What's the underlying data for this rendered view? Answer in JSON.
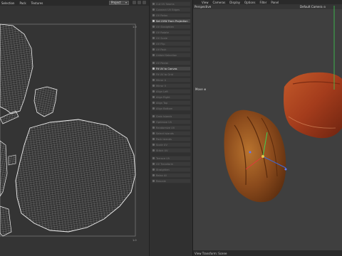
{
  "uv_editor": {
    "menu": [
      "Selection",
      "Pack",
      "Textures"
    ],
    "mode_dropdown": "Project",
    "tick_top": "1.0",
    "tick_bottom": "1.0"
  },
  "tools": [
    {
      "label": "Cut UV Seams",
      "active": false
    },
    {
      "label": "Connect UV Edges",
      "active": false
    },
    {
      "label": "UV Relax",
      "active": false
    },
    {
      "label": "Set UVW From Projection",
      "active": true
    },
    {
      "label": "UV Straighten",
      "active": false
    },
    {
      "label": "UV Rotate",
      "active": false
    },
    {
      "label": "UV Scale",
      "active": false
    },
    {
      "label": "UV Flip",
      "active": false
    },
    {
      "label": "UV Pack",
      "active": false
    },
    {
      "label": "Unfold Selection",
      "active": false
    },
    {
      "label": "UV Peeler",
      "active": false
    },
    {
      "label": "Fit UV to Canvas",
      "active": true
    },
    {
      "label": "Fit UV to Grid",
      "active": false
    },
    {
      "label": "Mirror U",
      "active": false
    },
    {
      "label": "Mirror V",
      "active": false
    },
    {
      "label": "Align Left",
      "active": false
    },
    {
      "label": "Align Right",
      "active": false
    },
    {
      "label": "Align Top",
      "active": false
    },
    {
      "label": "Align Bottom",
      "active": false
    },
    {
      "label": "Grab Islands",
      "active": false
    },
    {
      "label": "Optimize UV",
      "active": false
    },
    {
      "label": "Randomize UV",
      "active": false
    },
    {
      "label": "Select Islands",
      "active": false
    },
    {
      "label": "Pack Islands",
      "active": false
    },
    {
      "label": "Scale UV",
      "active": false
    },
    {
      "label": "Stitch UV",
      "active": false
    },
    {
      "label": "Terrace UV",
      "active": false
    },
    {
      "label": "UV Transform",
      "active": false
    },
    {
      "label": "Straighten",
      "active": false
    },
    {
      "label": "Relax All",
      "active": false
    },
    {
      "label": "Rescale",
      "active": false
    }
  ],
  "viewport": {
    "menu": [
      "View",
      "Cameras",
      "Display",
      "Options",
      "Filter",
      "Panel"
    ],
    "view_name": "Perspective",
    "camera": "Default Camera ⊙",
    "move_label": "Move ⊕",
    "status": "View Transform: Scene"
  },
  "colors": {
    "accent": "#3ecf52",
    "wire": "#e8e8e8"
  }
}
